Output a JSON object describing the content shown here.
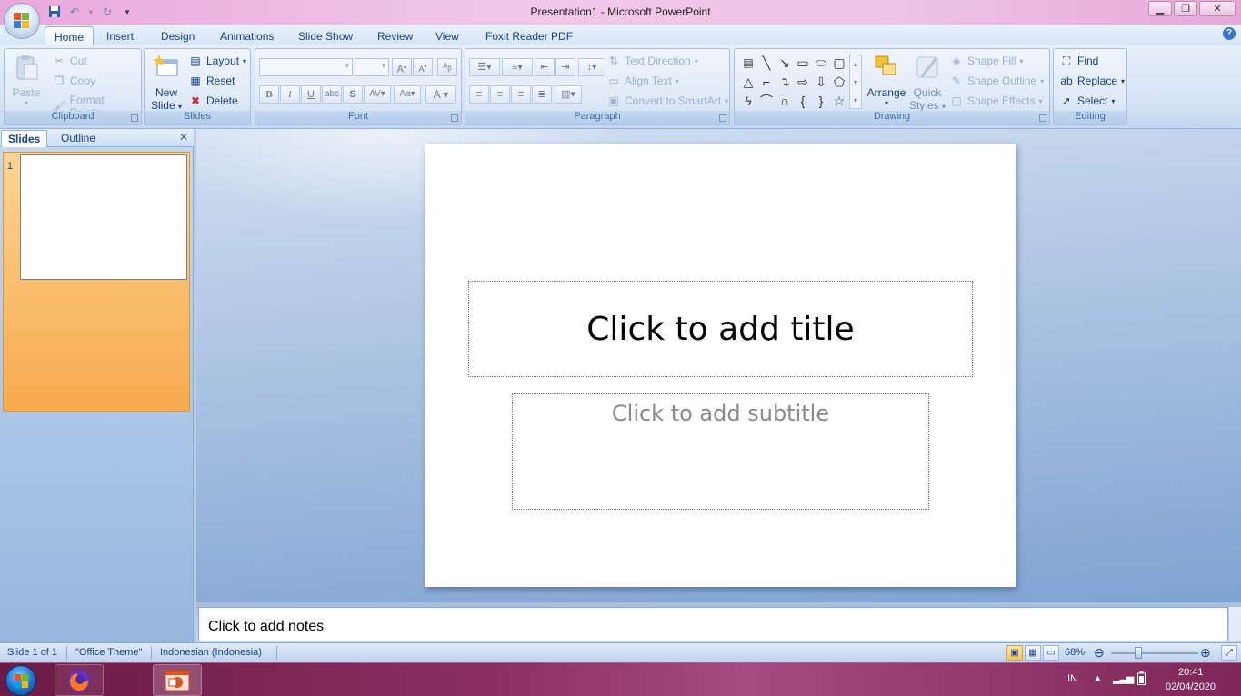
{
  "window": {
    "title": "Presentation1 - Microsoft PowerPoint",
    "controls": [
      "minimize",
      "restore",
      "close"
    ]
  },
  "ribbon": {
    "tabs": [
      "Home",
      "Insert",
      "Design",
      "Animations",
      "Slide Show",
      "Review",
      "View",
      "Foxit Reader PDF"
    ],
    "active_tab": "Home",
    "clipboard": {
      "label": "Clipboard",
      "paste": "Paste",
      "cut": "Cut",
      "copy": "Copy",
      "format_painter": "Format Painter"
    },
    "slides": {
      "label": "Slides",
      "new_slide_line1": "New",
      "new_slide_line2": "Slide",
      "layout": "Layout",
      "reset": "Reset",
      "delete": "Delete"
    },
    "font": {
      "label": "Font"
    },
    "paragraph": {
      "label": "Paragraph",
      "text_direction": "Text Direction",
      "align_text": "Align Text",
      "convert_smartart": "Convert to SmartArt"
    },
    "drawing": {
      "label": "Drawing",
      "arrange": "Arrange",
      "quick_styles_line1": "Quick",
      "quick_styles_line2": "Styles",
      "shape_fill": "Shape Fill",
      "shape_outline": "Shape Outline",
      "shape_effects": "Shape Effects"
    },
    "editing": {
      "label": "Editing",
      "find": "Find",
      "replace": "Replace",
      "select": "Select"
    }
  },
  "panel": {
    "tabs": [
      "Slides",
      "Outline"
    ],
    "active_tab": "Slides",
    "slide_number": "1"
  },
  "slide": {
    "title_placeholder": "Click to add title",
    "subtitle_placeholder": "Click to add subtitle"
  },
  "notes": {
    "placeholder": "Click to add notes"
  },
  "status": {
    "slide_of": "Slide 1 of 1",
    "theme": "\"Office Theme\"",
    "language": "Indonesian (Indonesia)",
    "zoom": "68%",
    "zoom_level": 0.68
  },
  "taskbar": {
    "lang": "IN",
    "time": "20:41",
    "date": "02/04/2020"
  },
  "colors": {
    "ribbon_text": "#15428b",
    "title_bar": "#f1c7e9",
    "taskbar": "#8b2f63",
    "selection": "#f7a94e"
  }
}
